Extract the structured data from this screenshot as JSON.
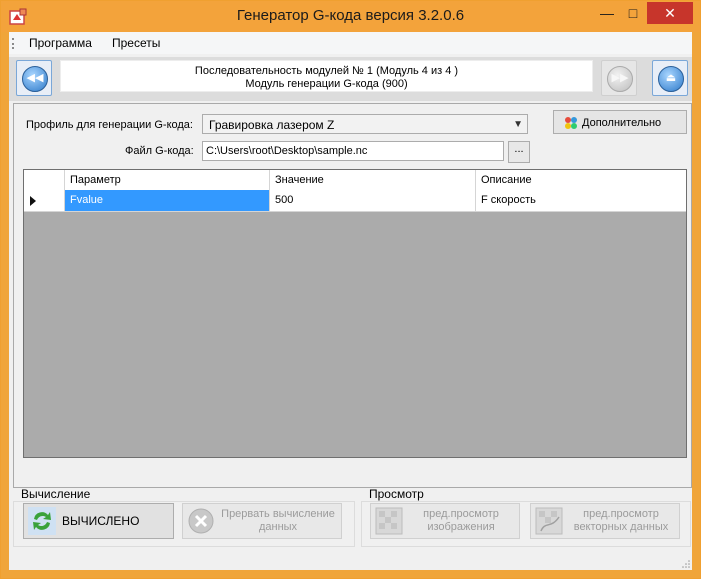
{
  "window": {
    "title": "Генератор G-кода версия 3.2.0.6",
    "controls": {
      "minimize": "—",
      "maximize": "□",
      "close": "✕"
    }
  },
  "menu": [
    "Программа",
    "Пресеты"
  ],
  "sequence": {
    "line1": "Последовательность модулей № 1 (Модуль 4 из 4 )",
    "line2": "Модуль генерации G-кода (900)"
  },
  "form": {
    "profile_label": "Профиль для генерации G-кода:",
    "profile_value": "Гравировка лазером Z",
    "file_label": "Файл G-кода:",
    "file_value": "C:\\Users\\root\\Desktop\\sample.nc",
    "browse_label": "...",
    "additional_button": "Дополнительно"
  },
  "grid": {
    "columns": [
      "Параметр",
      "Значение",
      "Описание"
    ],
    "rows": [
      {
        "param": "Fvalue",
        "value": "500",
        "description": "F скорость"
      }
    ]
  },
  "calc_group": {
    "label": "Вычисление",
    "calc_button": "ВЫЧИСЛЕНО",
    "abort_button": "Прервать вычисление данных"
  },
  "preview_group": {
    "label": "Просмотр",
    "image_button": "пред.просмотр изображения",
    "vector_button": "пред.просмотр векторных данных"
  },
  "colors": {
    "titlebar": "#f3a33b",
    "close_button": "#c7352b",
    "selection": "#3399ff",
    "grid_background": "#ababab"
  },
  "icons": {
    "nav_back": "rewind-icon",
    "nav_forward": "fast-forward-icon",
    "nav_eject": "eject-icon",
    "calc": "refresh-arrows-icon",
    "abort": "cancel-x-icon",
    "image_preview": "image-preview-icon",
    "vector_preview": "vector-preview-icon"
  }
}
